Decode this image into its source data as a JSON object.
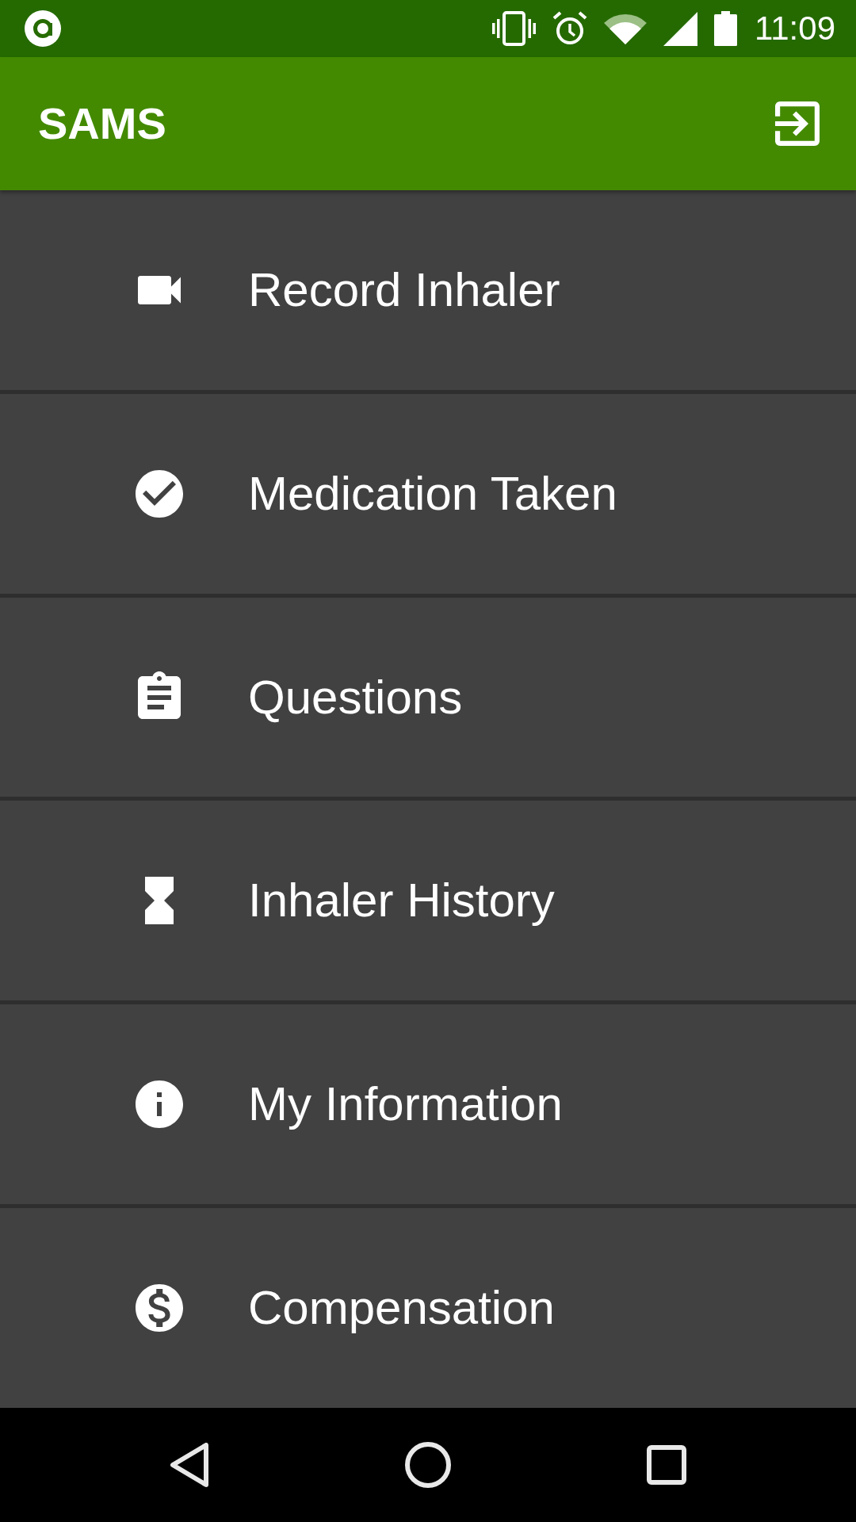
{
  "status_bar": {
    "time": "11:09"
  },
  "app_bar": {
    "title": "SAMS"
  },
  "menu": {
    "items": [
      {
        "label": "Record Inhaler"
      },
      {
        "label": "Medication Taken"
      },
      {
        "label": "Questions"
      },
      {
        "label": "Inhaler History"
      },
      {
        "label": "My Information"
      },
      {
        "label": "Compensation"
      }
    ]
  }
}
